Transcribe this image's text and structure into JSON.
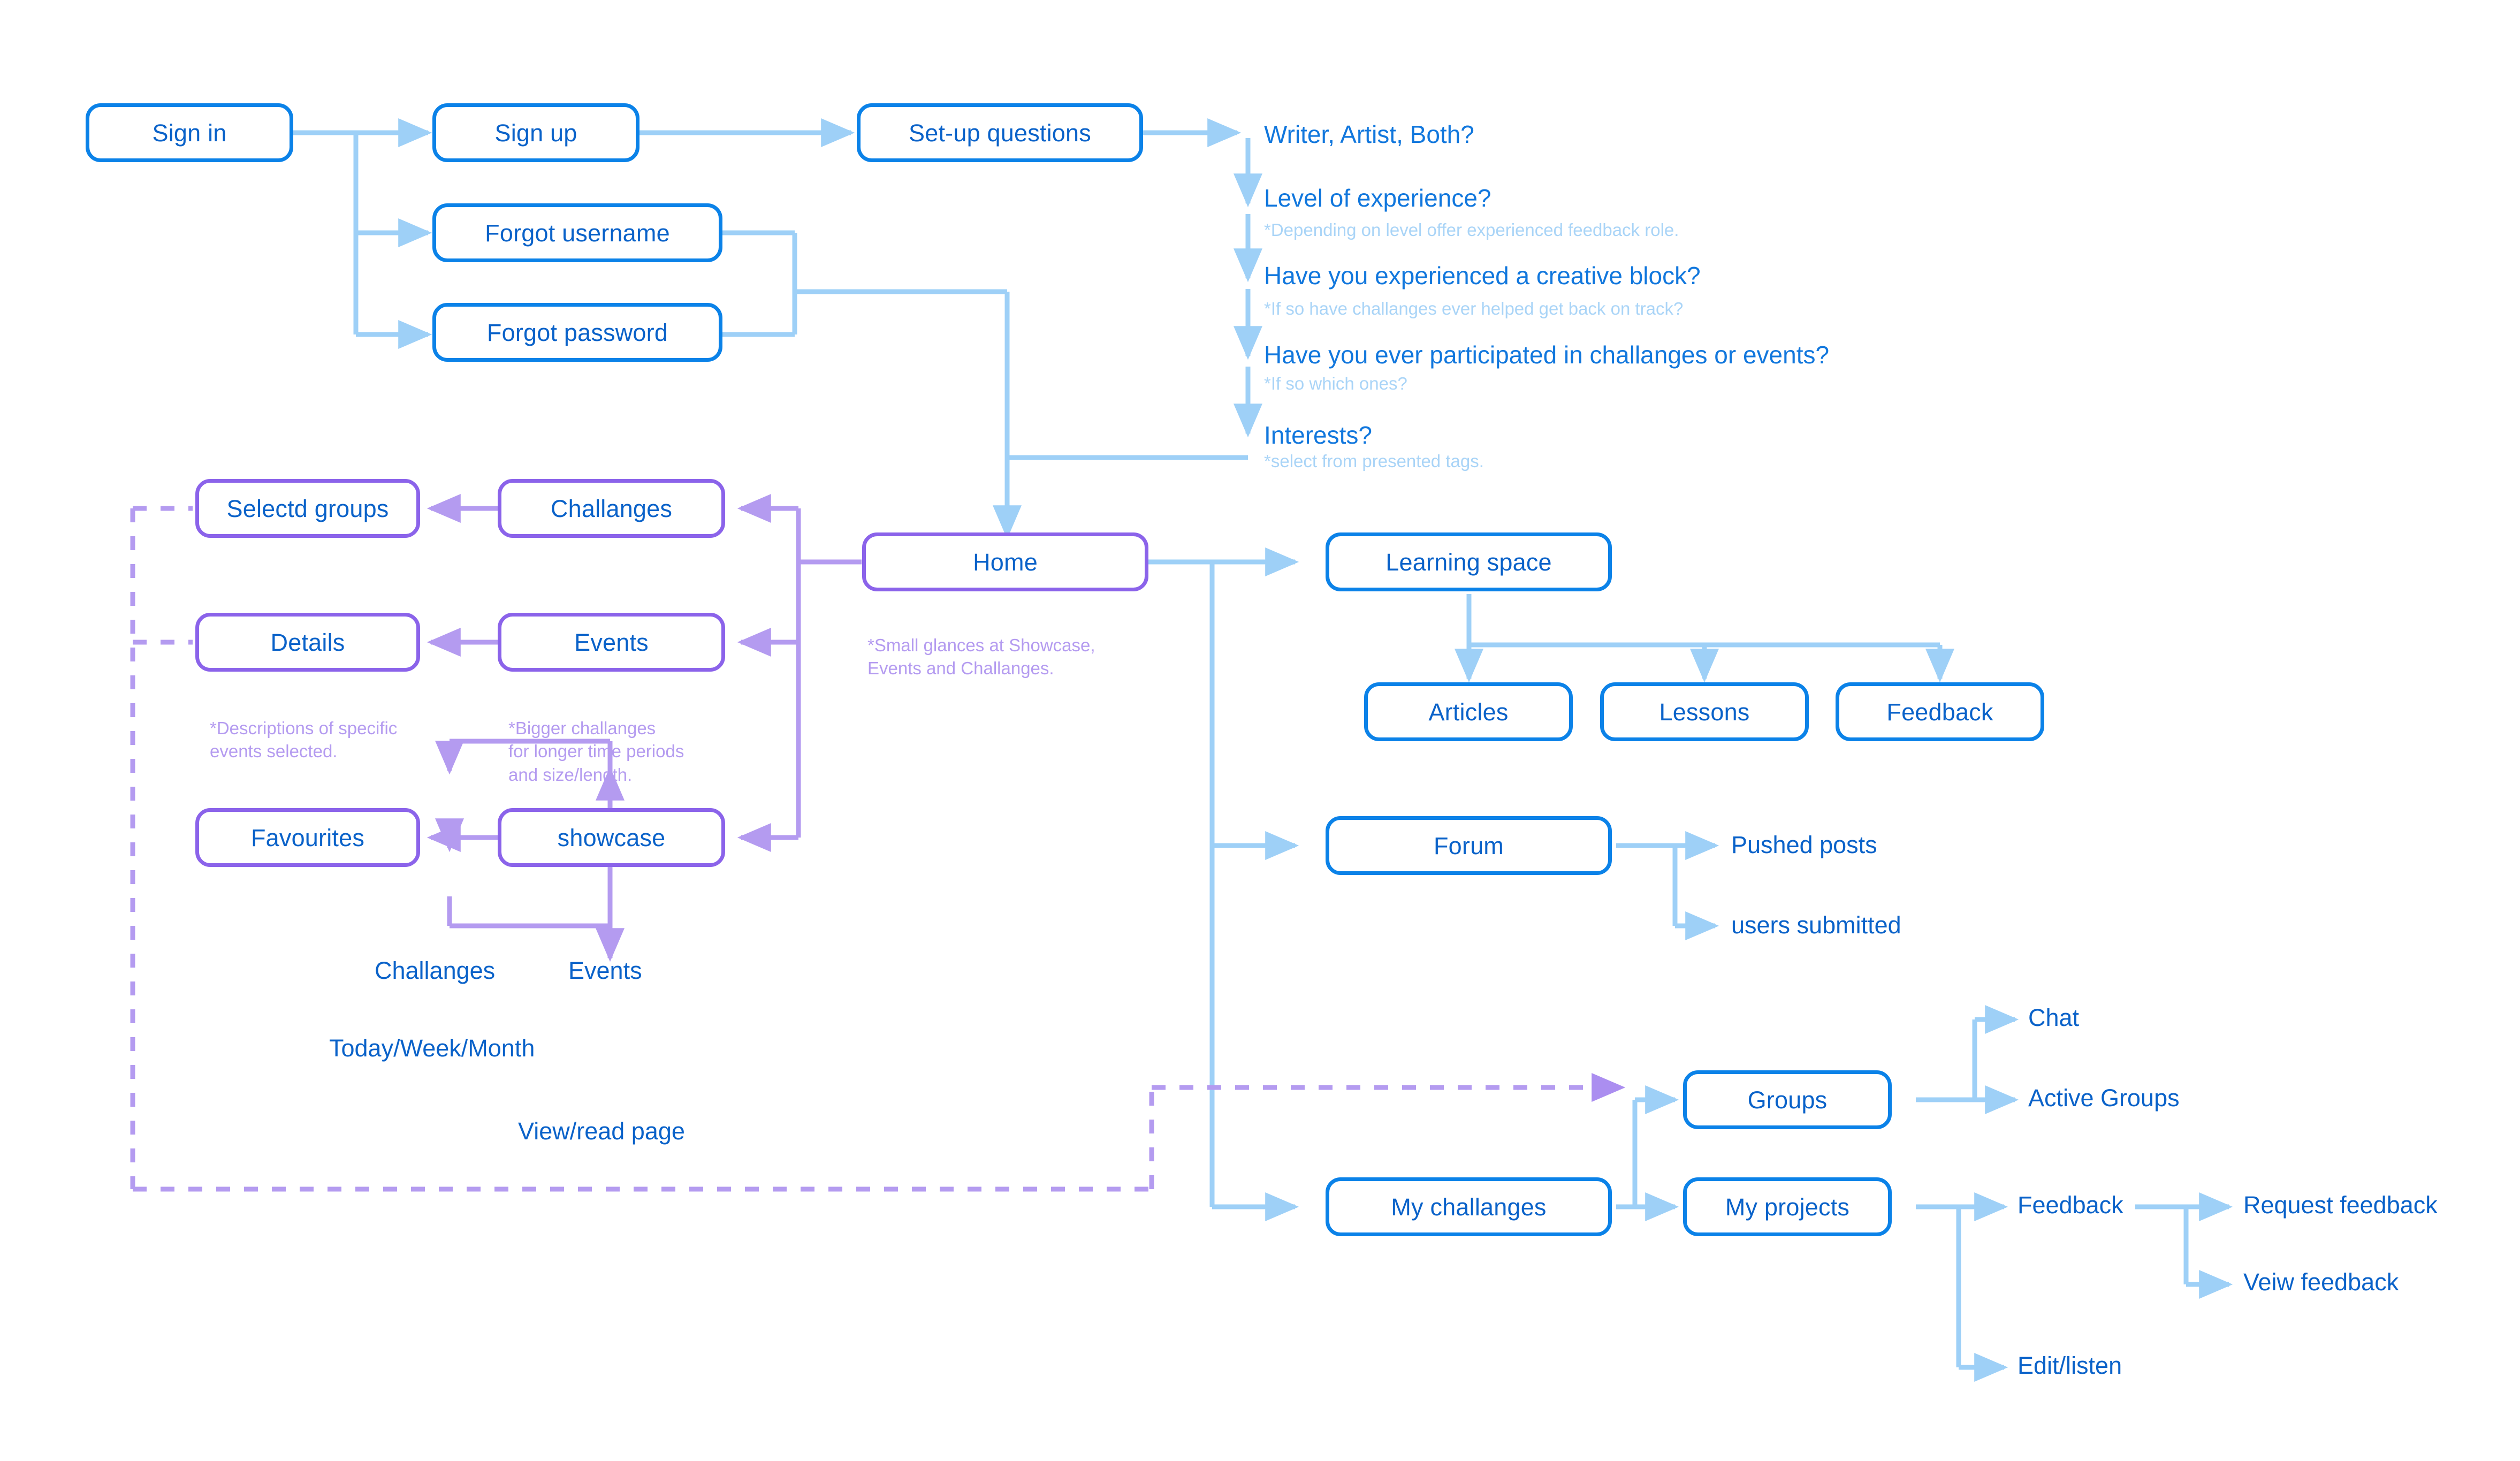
{
  "diagram": {
    "title": "App user flow / sitemap",
    "colors": {
      "node_blue_border": "#0b82e8",
      "node_purple_border": "#8b63ea",
      "text_blue": "#0a62c9",
      "wire_blue": "#9ed0f7",
      "wire_purple": "#b49bf0",
      "question_text": "#1177dd",
      "question_sub": "#a9d4f7",
      "note_purple": "#b49bf0",
      "background": "#ffffff"
    }
  },
  "auth": {
    "sign_in": "Sign in",
    "sign_up": "Sign up",
    "forgot_username": "Forgot username",
    "forgot_password": "Forgot password",
    "setup_questions": "Set-up questions"
  },
  "questions": [
    {
      "main": "Writer, Artist, Both?",
      "sub": ""
    },
    {
      "main": "Level of experience?",
      "sub": "*Depending on level offer experienced feedback role."
    },
    {
      "main": "Have you experienced a creative block?",
      "sub": "*If so have challanges ever helped get back on track?"
    },
    {
      "main": "Have you ever participated in challanges or events?",
      "sub": "*If so which ones?"
    },
    {
      "main": "Interests?",
      "sub": "*select from presented tags."
    }
  ],
  "home": {
    "label": "Home",
    "note": "*Small glances at Showcase,\nEvents and Challanges."
  },
  "left_branch": {
    "selected_groups": "Selectd groups",
    "challanges": "Challanges",
    "details": "Details",
    "details_note": "*Descriptions of specific\nevents selected.",
    "events": "Events",
    "events_note": "*Bigger challanges\nfor longer time periods\nand size/length.",
    "favourites": "Favourites",
    "showcase": "showcase"
  },
  "showcase_branch": {
    "challanges": "Challanges",
    "events": "Events",
    "today_week_month": "Today/Week/Month",
    "view_read_page": "View/read page"
  },
  "learning": {
    "learning_space": "Learning space",
    "articles": "Articles",
    "lessons": "Lessons",
    "feedback": "Feedback"
  },
  "forum": {
    "forum": "Forum",
    "pushed_posts": "Pushed posts",
    "users_submitted": "users submitted"
  },
  "groups": {
    "groups": "Groups",
    "chat": "Chat",
    "active_groups": "Active Groups"
  },
  "projects": {
    "my_challanges": "My challanges",
    "my_projects": "My projects",
    "feedback": "Feedback",
    "request_feedback": "Request feedback",
    "view_feedback": "Veiw feedback",
    "edit_listen": "Edit/listen"
  }
}
